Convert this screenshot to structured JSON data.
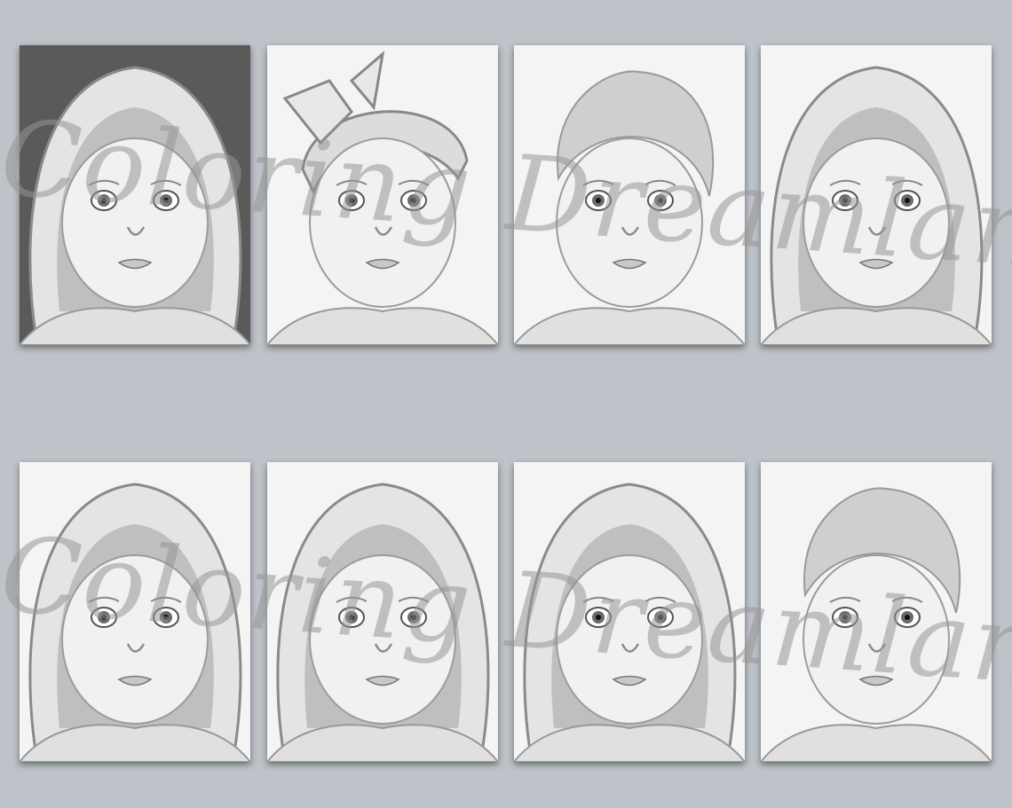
{
  "watermark": {
    "text": "Coloring Dreamland"
  },
  "cards": [
    {
      "name": "baby-portrait-1",
      "headwear": "hood"
    },
    {
      "name": "baby-portrait-2",
      "headwear": "bow-headband"
    },
    {
      "name": "baby-portrait-3",
      "headwear": "none"
    },
    {
      "name": "baby-portrait-4",
      "headwear": "hood"
    },
    {
      "name": "baby-portrait-5",
      "headwear": "hood"
    },
    {
      "name": "baby-portrait-6",
      "headwear": "hood"
    },
    {
      "name": "baby-portrait-7",
      "headwear": "hood"
    },
    {
      "name": "baby-portrait-8",
      "headwear": "none"
    }
  ]
}
